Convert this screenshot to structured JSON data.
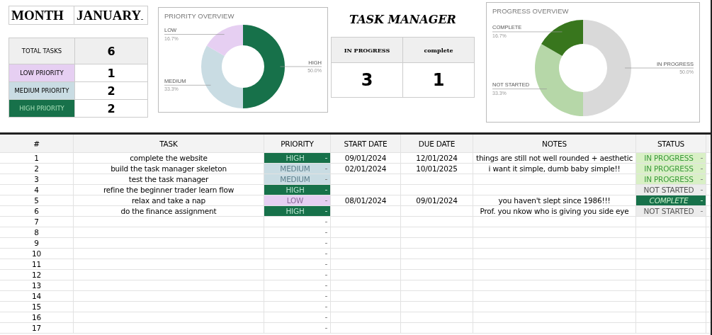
{
  "month": {
    "label": "MONTH",
    "value": "JANUARY"
  },
  "summary": [
    {
      "kind": "total",
      "label": "TOTAL TASKS",
      "count": "6"
    },
    {
      "kind": "low",
      "label": "LOW PRIORITY",
      "count": "1"
    },
    {
      "kind": "medium",
      "label": "MEDIUM PRIORITY",
      "count": "2"
    },
    {
      "kind": "high",
      "label": "HIGH PRIORITY",
      "count": "2"
    }
  ],
  "priority_chart": {
    "chart_data": {
      "type": "donut",
      "title": "PRIORITY OVERVIEW",
      "categories": [
        "HIGH",
        "MEDIUM",
        "LOW"
      ],
      "values": [
        50,
        33.3,
        16.7
      ],
      "value_labels": [
        "50.0%",
        "33.3%",
        "16.7%"
      ]
    }
  },
  "title": "TASK MANAGER",
  "status_counts": [
    {
      "label": "IN PROGRESS",
      "count": "3"
    },
    {
      "label": "complete",
      "count": "1"
    }
  ],
  "progress_chart": {
    "chart_data": {
      "type": "donut",
      "title": "PROGRESS OVERVIEW",
      "categories": [
        "IN PROGRESS",
        "NOT STARTED",
        "COMPLETE"
      ],
      "values": [
        50,
        33.3,
        16.7
      ],
      "value_labels": [
        "50.0%",
        "33.3%",
        "16.7%"
      ]
    }
  },
  "table": {
    "columns": [
      "#",
      "TASK",
      "PRIORITY",
      "START DATE",
      "DUE DATE",
      "NOTES",
      "STATUS"
    ],
    "rows": [
      {
        "n": "1",
        "task": "complete the website",
        "priority": {
          "kind": "high",
          "label": "HIGH"
        },
        "start": "09/01/2024",
        "due": "12/01/2024",
        "notes": "things are still not well rounded + aesthetic",
        "status": {
          "kind": "in_progress",
          "label": "IN PROGRESS"
        }
      },
      {
        "n": "2",
        "task": "build the task manager skeleton",
        "priority": {
          "kind": "medium",
          "label": "MEDIUM"
        },
        "start": "02/01/2024",
        "due": "10/01/2025",
        "notes": "i want it simple, dumb baby simple!!",
        "status": {
          "kind": "in_progress",
          "label": "IN PROGRESS"
        }
      },
      {
        "n": "3",
        "task": "test the task manager",
        "priority": {
          "kind": "medium",
          "label": "MEDIUM"
        },
        "status": {
          "kind": "in_progress",
          "label": "IN PROGRESS"
        }
      },
      {
        "n": "4",
        "task": "refine the beginner trader learn flow",
        "priority": {
          "kind": "high",
          "label": "HIGH"
        },
        "status": {
          "kind": "not_started",
          "label": "NOT STARTED"
        }
      },
      {
        "n": "5",
        "task": "relax and take a nap",
        "priority": {
          "kind": "low",
          "label": "LOW"
        },
        "start": "08/01/2024",
        "due": "09/01/2024",
        "notes": "you haven't slept since 1986!!!",
        "status": {
          "kind": "complete",
          "label": "COMPLETE"
        }
      },
      {
        "n": "6",
        "task": "do the finance assignment",
        "priority": {
          "kind": "high",
          "label": "HIGH"
        },
        "notes": "Prof. you nkow who is giving you side eye",
        "status": {
          "kind": "not_started",
          "label": "NOT STARTED"
        }
      },
      {
        "n": "7"
      },
      {
        "n": "8"
      },
      {
        "n": "9"
      },
      {
        "n": "10"
      },
      {
        "n": "11"
      },
      {
        "n": "12"
      },
      {
        "n": "13"
      },
      {
        "n": "14"
      },
      {
        "n": "15"
      },
      {
        "n": "16"
      },
      {
        "n": "17"
      }
    ]
  }
}
